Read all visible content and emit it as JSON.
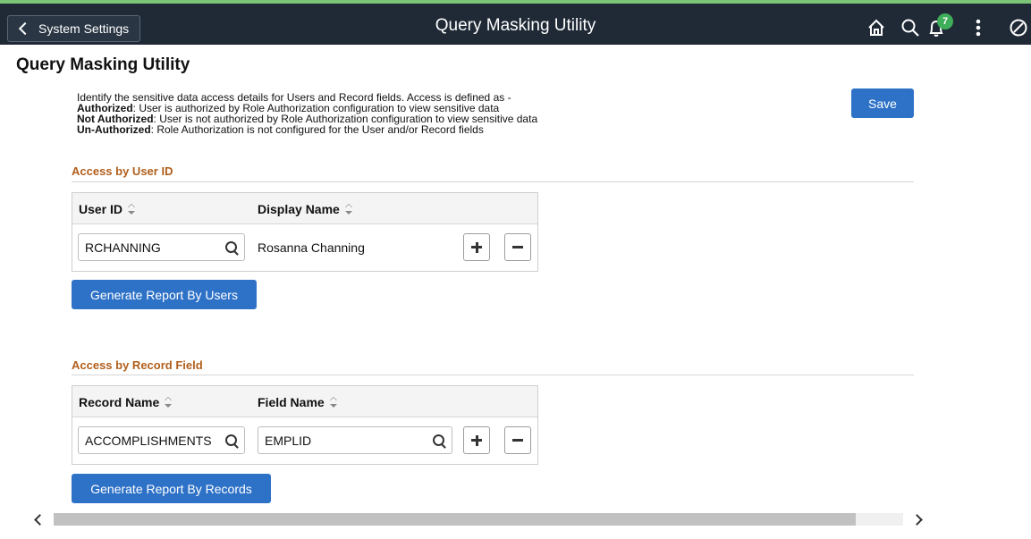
{
  "header": {
    "back_label": "System Settings",
    "title": "Query Masking Utility",
    "notification_count": "7",
    "icons": [
      "home-icon",
      "search-icon",
      "notifications-icon",
      "actions-menu-icon",
      "navbar-icon"
    ],
    "bg_color": "#1f2a36"
  },
  "page": {
    "title": "Query Masking Utility",
    "intro": {
      "line1": "Identify the sensitive data access details for Users and Record fields. Access is defined as -",
      "authorized_term": "Authorized",
      "authorized_desc": ": User is authorized by Role Authorization configuration to view sensitive data",
      "not_authorized_term": "Not Authorized",
      "not_authorized_desc": ": User is not authorized by Role Authorization configuration to view sensitive data",
      "unauthorized_term": "Un-Authorized",
      "unauthorized_desc": ": Role Authorization is not configured for the User and/or Record fields"
    },
    "save_label": "Save"
  },
  "user_section": {
    "title": "Access by User ID",
    "columns": [
      "User ID",
      "Display Name"
    ],
    "rows": [
      {
        "user_id": "RCHANNING",
        "display_name": "Rosanna Channing"
      }
    ],
    "generate_label": "Generate Report By Users"
  },
  "record_section": {
    "title": "Access by Record Field",
    "columns": [
      "Record Name",
      "Field Name"
    ],
    "rows": [
      {
        "record_name": "ACCOMPLISHMENTS",
        "field_name": "EMPLID"
      }
    ],
    "generate_label": "Generate Report By Records"
  },
  "colors": {
    "accent": "#2e72c7",
    "section_title": "#b15f1b",
    "badge": "#3fae5a"
  }
}
